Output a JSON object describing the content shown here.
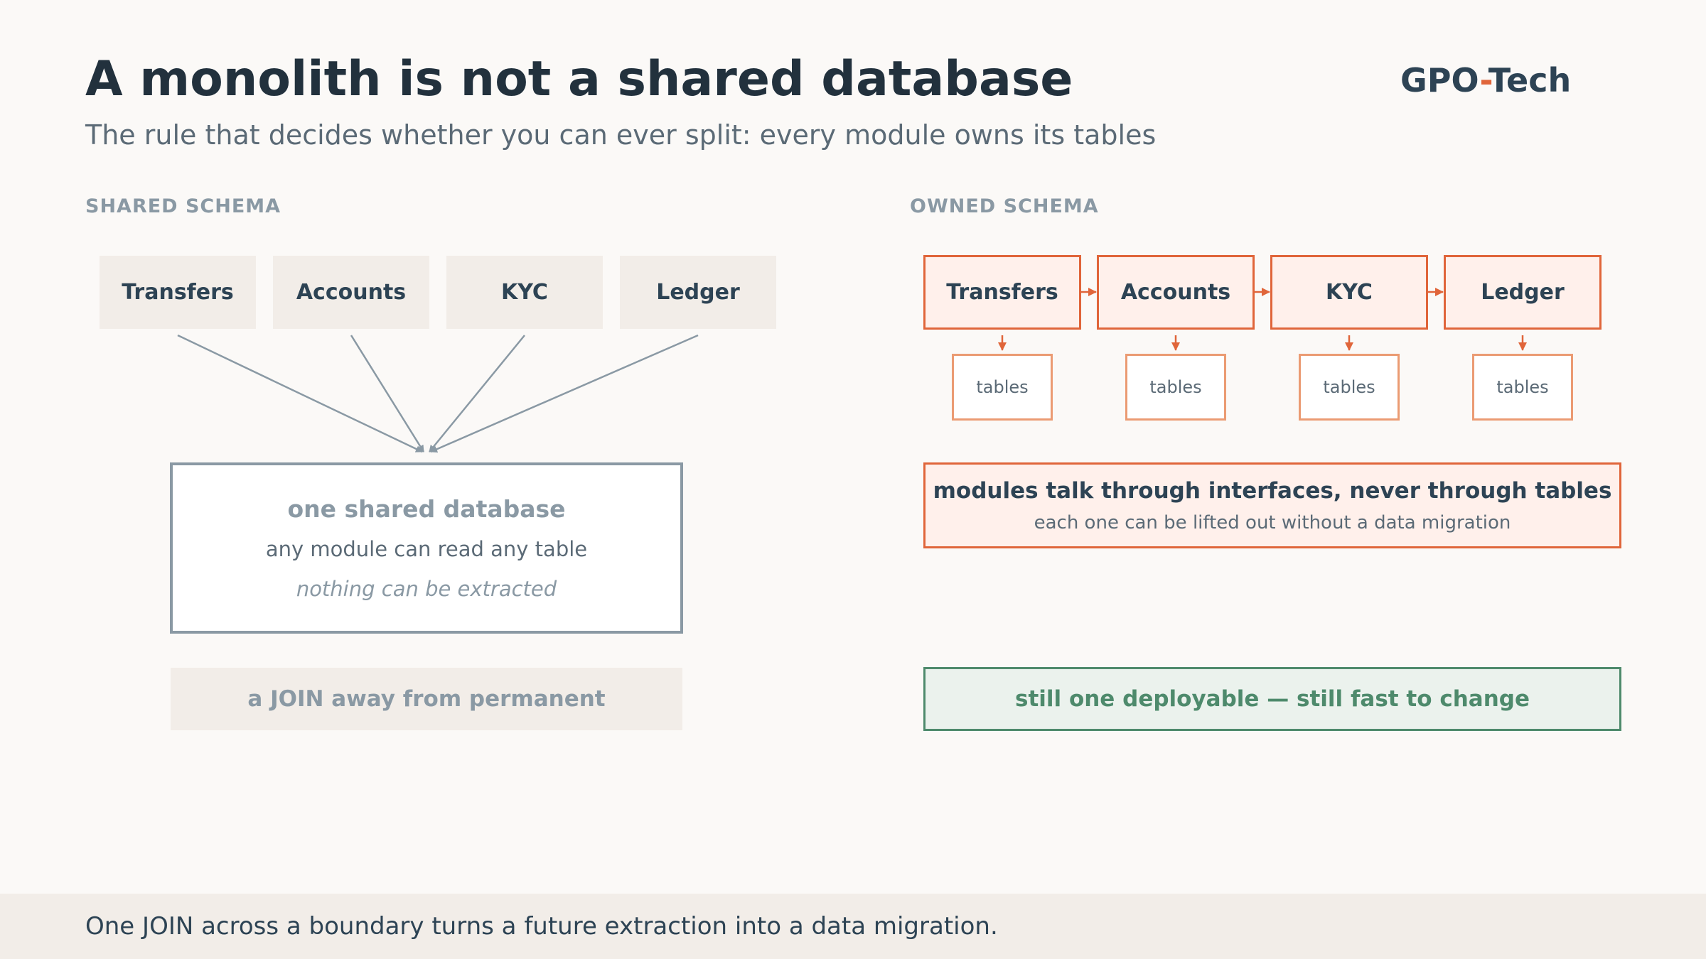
{
  "header": {
    "title": "A monolith is not a shared database",
    "subtitle": "The rule that decides whether you can ever split: every module owns its tables",
    "logo_left": "GPO",
    "logo_dash": "-",
    "logo_right": "Tech"
  },
  "shared": {
    "section_label": "SHARED SCHEMA",
    "modules": [
      "Transfers",
      "Accounts",
      "KYC",
      "Ledger"
    ],
    "db_title": "one shared database",
    "db_line1": "any module can read any table",
    "db_line2": "nothing can be extracted",
    "join_note": "a JOIN away from permanent"
  },
  "owned": {
    "section_label": "OWNED SCHEMA",
    "modules": [
      "Transfers",
      "Accounts",
      "KYC",
      "Ledger"
    ],
    "tables_label": "tables",
    "interface_title": "modules talk through interfaces, never through tables",
    "interface_sub": "each one can be lifted out without a data migration",
    "deploy_note": "still one deployable — still fast to change"
  },
  "footer": {
    "text": "One JOIN across a boundary turns a future extraction into a data migration."
  },
  "colors": {
    "accent": "#e0653a",
    "muted": "#8a99a4",
    "green": "#4e8a6c",
    "dark": "#22313d"
  }
}
